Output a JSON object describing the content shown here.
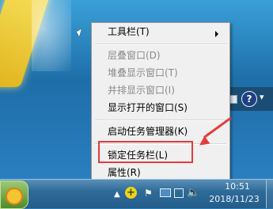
{
  "context_menu": {
    "items": [
      {
        "label": "工具栏(T)",
        "enabled": true,
        "submenu": true
      },
      {
        "label": "层叠窗口(D)",
        "enabled": false
      },
      {
        "label": "堆叠显示窗口(T)",
        "enabled": false
      },
      {
        "label": "并排显示窗口(I)",
        "enabled": false
      },
      {
        "label": "显示打开的窗口(S)",
        "enabled": true
      },
      {
        "label": "启动任务管理器(K)",
        "enabled": true
      },
      {
        "label": "锁定任务栏(L)",
        "enabled": true,
        "highlighted": true
      },
      {
        "label": "属性(R)",
        "enabled": true
      }
    ]
  },
  "taskbar": {
    "clock_time": "10:51",
    "clock_date": "2018/11/23",
    "tray_icons": [
      "show-hidden-icons-arrow",
      "green-plus-icon",
      "flag-icon",
      "monitor-icon",
      "screen-icon",
      "speaker-icon"
    ]
  },
  "desktop_toolbar": {
    "help_label": "?"
  },
  "annotation": {
    "highlight_color": "#e43c3c"
  }
}
